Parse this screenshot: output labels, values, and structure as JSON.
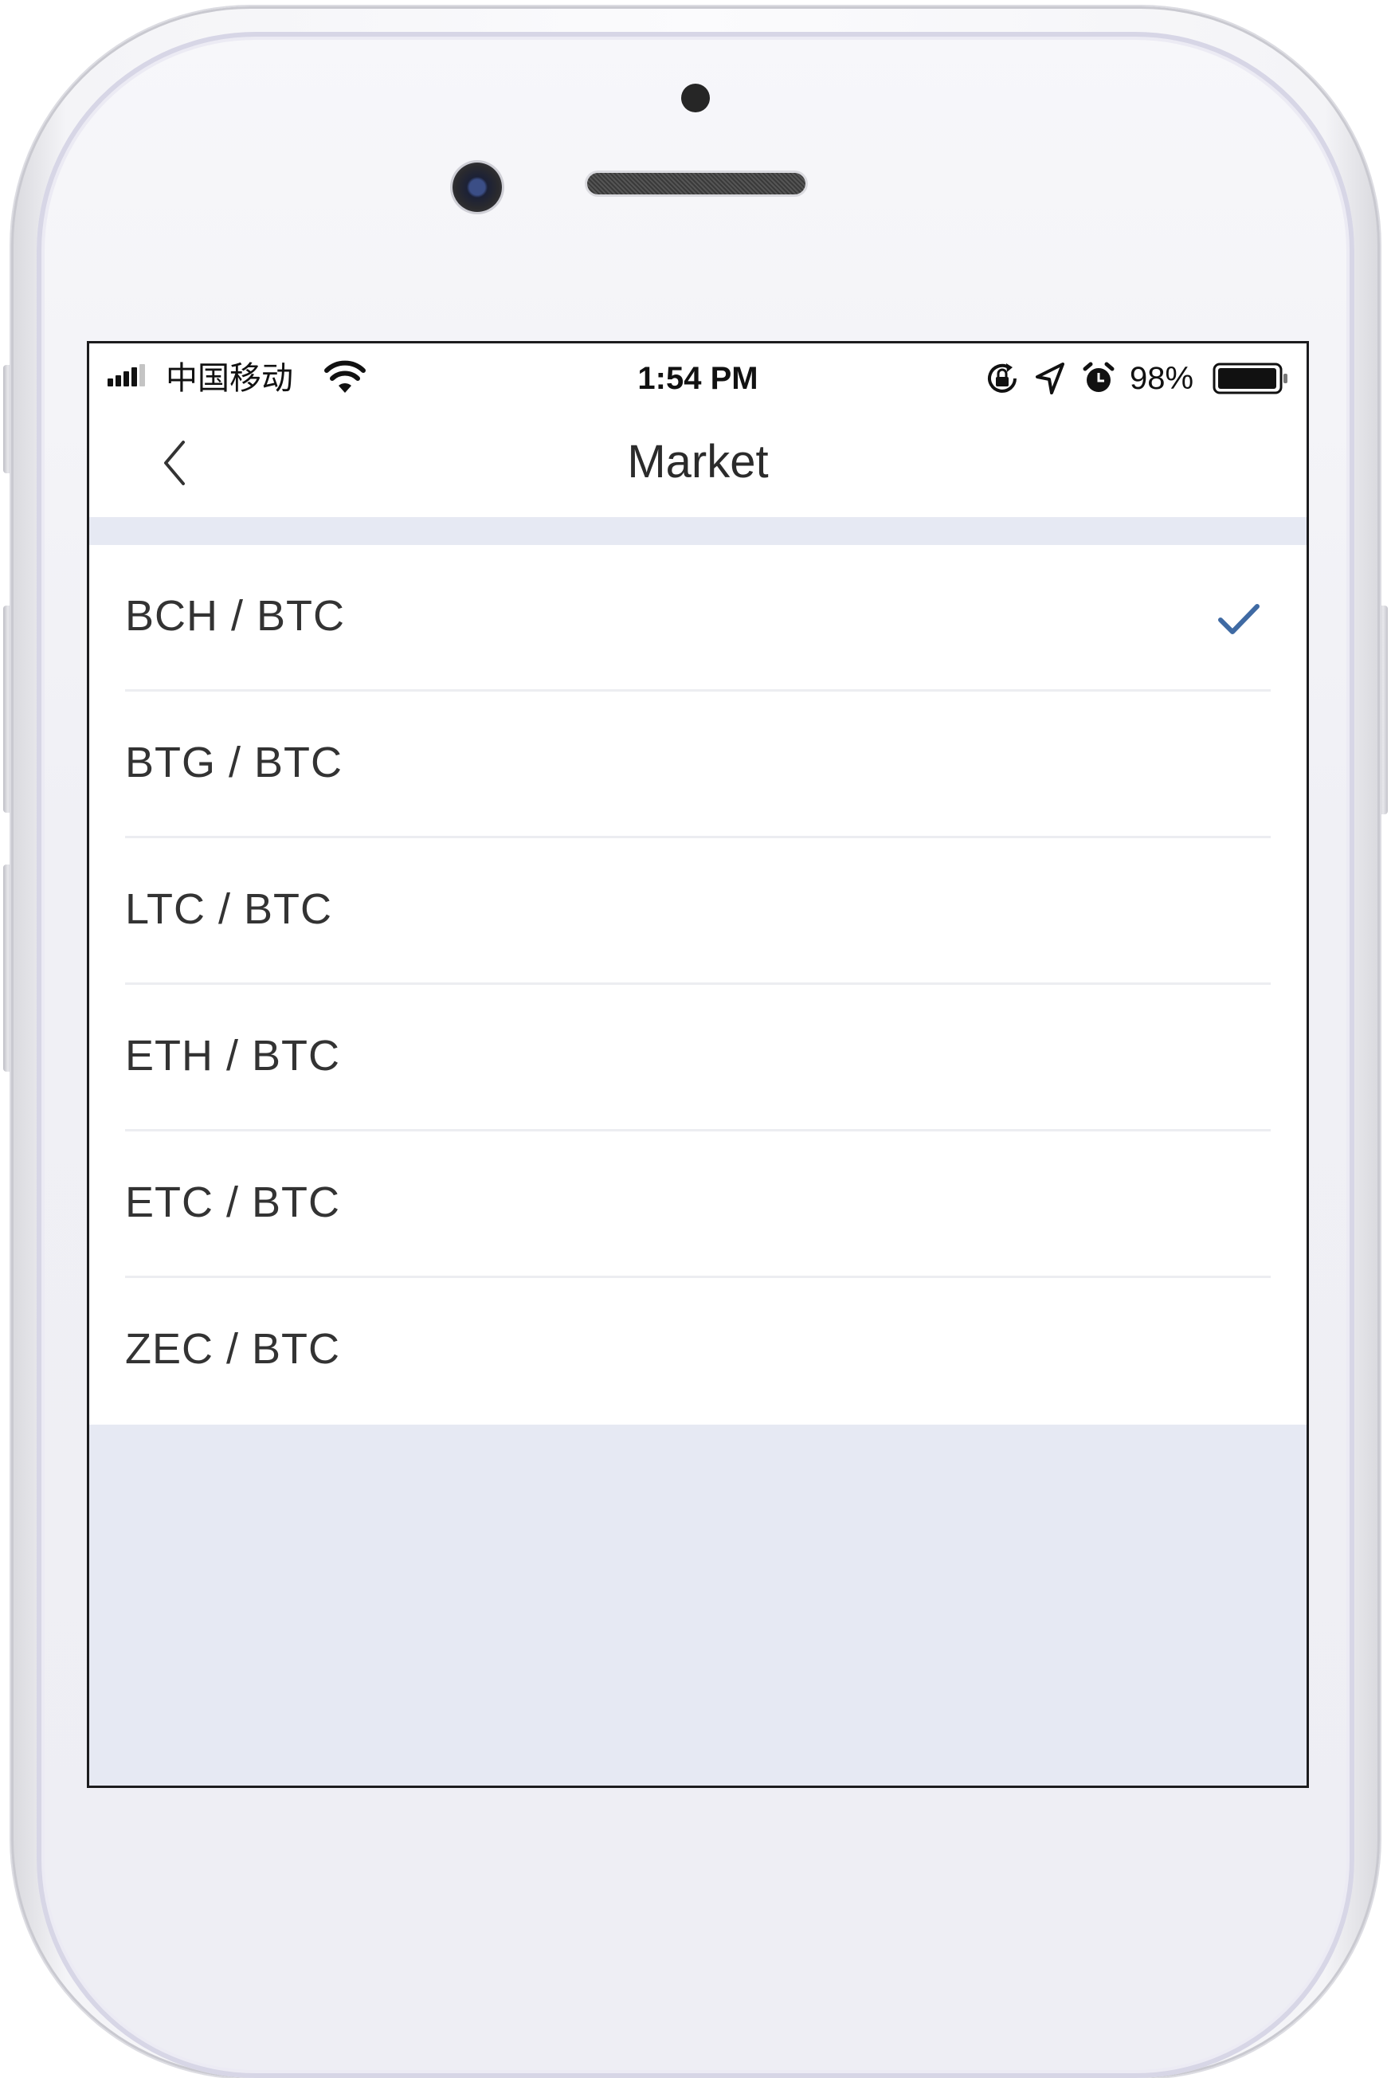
{
  "status_bar": {
    "carrier": "中国移动",
    "time": "1:54 PM",
    "battery_percent": "98%",
    "icons": [
      "signal-icon",
      "wifi-icon",
      "rotation-lock-icon",
      "location-icon",
      "alarm-icon",
      "battery-icon"
    ]
  },
  "nav": {
    "back_icon": "chevron-left-icon",
    "title": "Market"
  },
  "markets": [
    {
      "label": "BCH / BTC",
      "selected": true
    },
    {
      "label": "BTG / BTC",
      "selected": false
    },
    {
      "label": "LTC / BTC",
      "selected": false
    },
    {
      "label": "ETH / BTC",
      "selected": false
    },
    {
      "label": "ETC / BTC",
      "selected": false
    },
    {
      "label": "ZEC / BTC",
      "selected": false
    }
  ],
  "colors": {
    "accent": "#3f6aa3",
    "page_background": "#e6e9f3",
    "text": "#333333"
  }
}
